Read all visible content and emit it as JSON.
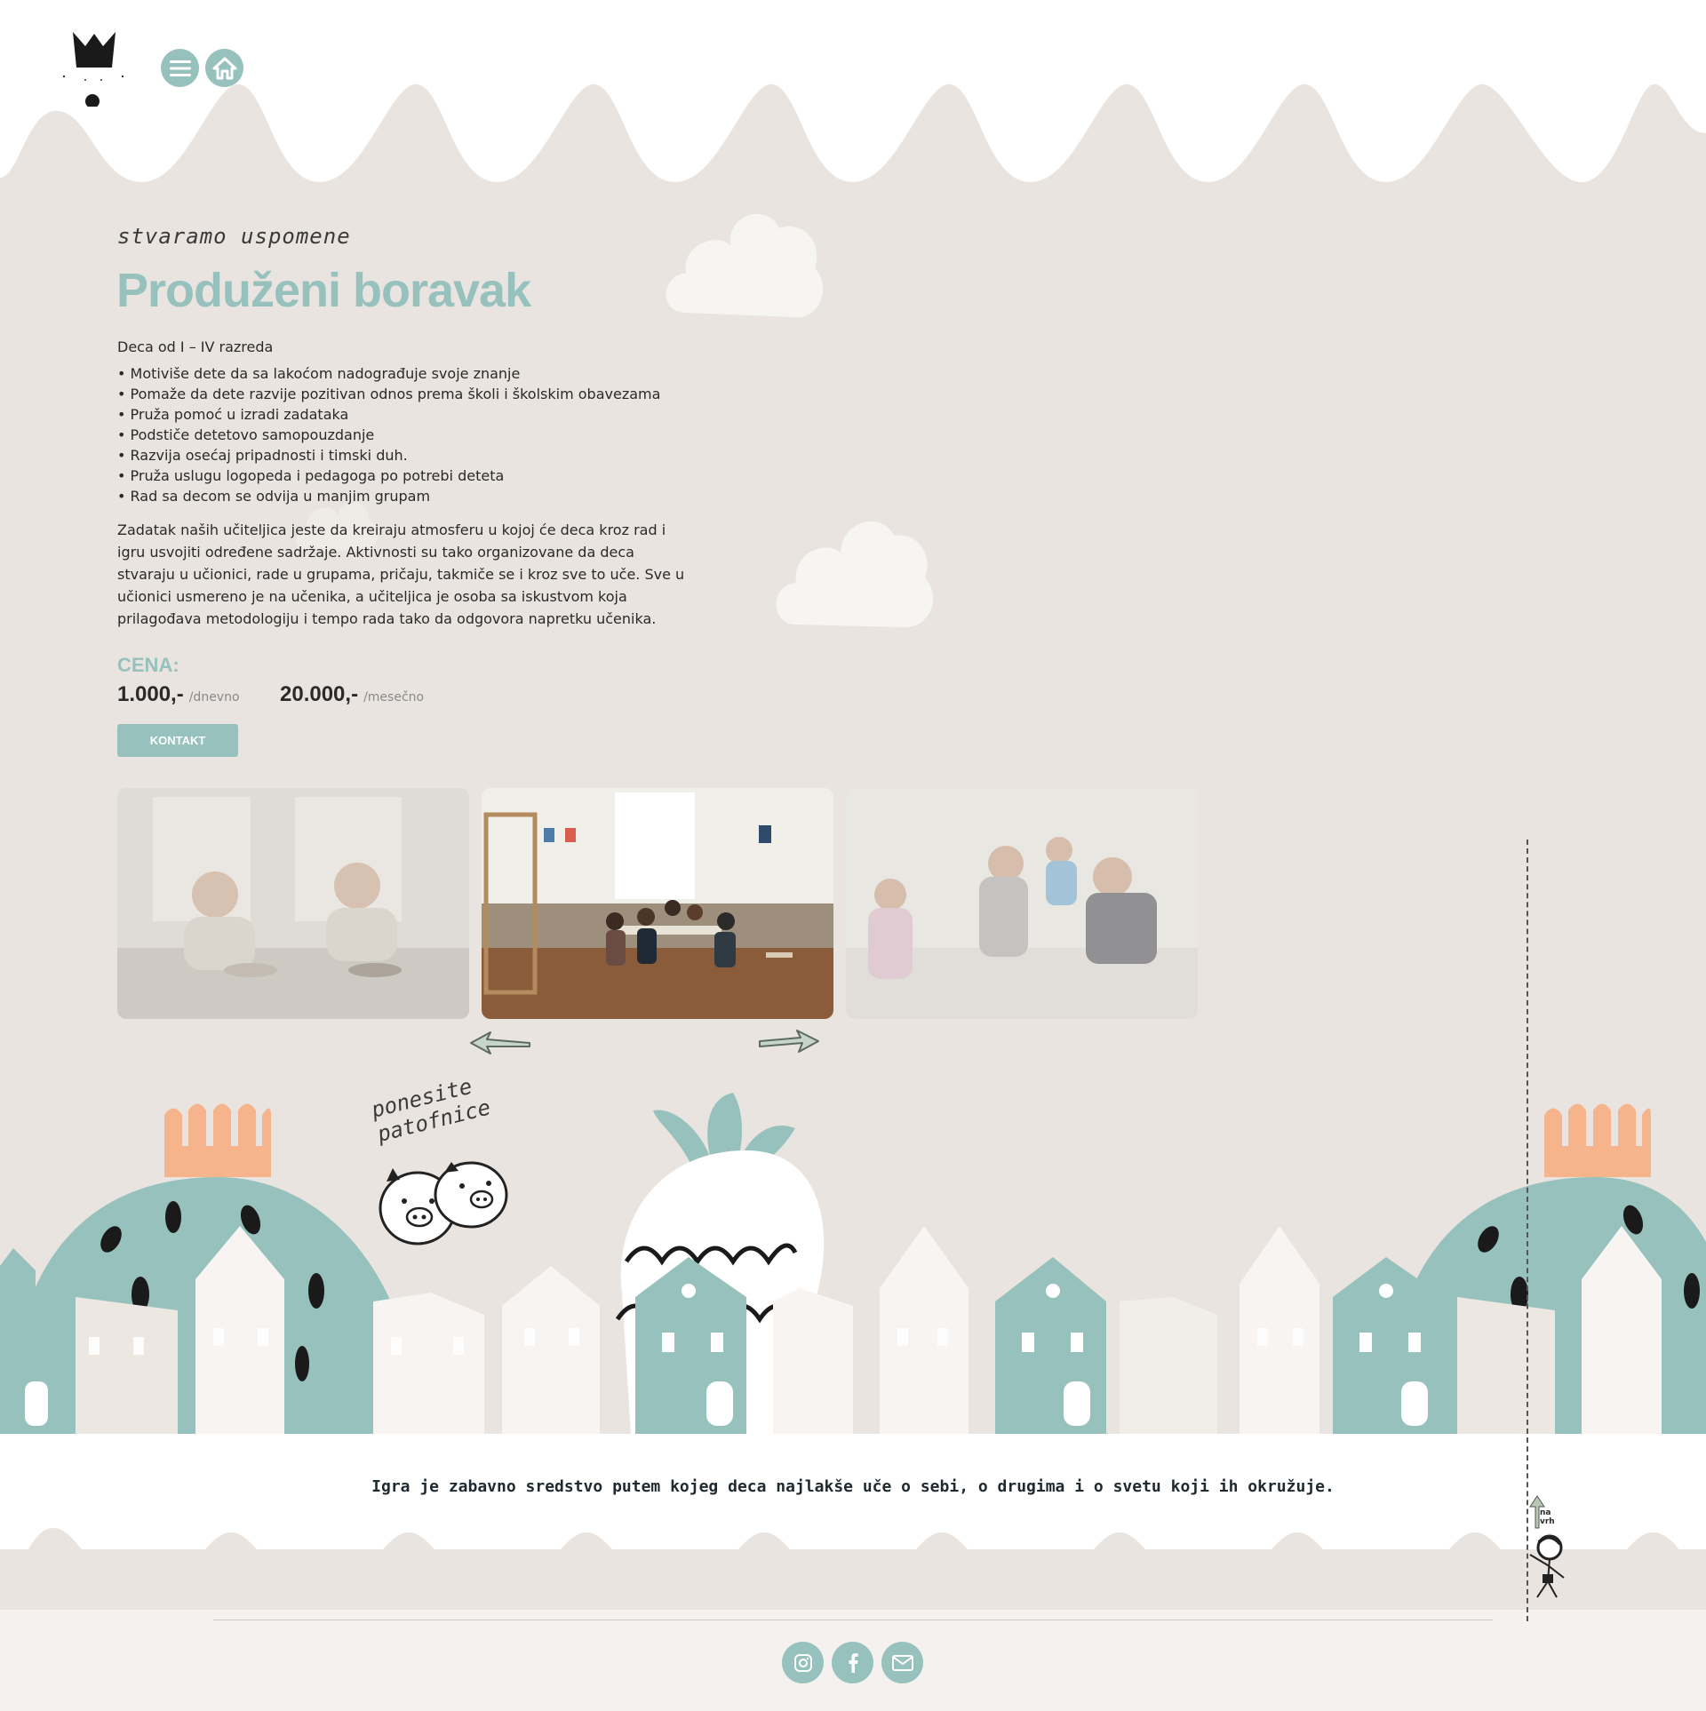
{
  "header": {
    "icons": [
      "crown-logo",
      "menu-icon",
      "home-icon"
    ]
  },
  "content": {
    "tagline": "stvaramo uspomene",
    "title": "Produženi boravak",
    "age_group": "Deca od I – IV razreda",
    "features": [
      "Motiviše dete da sa lakoćom nadograđuje svoje znanje",
      "Pomaže da dete razvije pozitivan odnos prema školi i školskim obavezama",
      "Pruža pomoć u izradi zadataka",
      "Podstiče detetovo samopouzdanje",
      "Razvija osećaj pripadnosti i timski duh.",
      "Pruža uslugu logopeda i pedagoga po potrebi deteta",
      "Rad sa decom se odvija u manjim grupam"
    ],
    "description": "Zadatak naših učiteljica jeste da kreiraju atmosferu u kojoj će deca kroz rad i igru usvojiti određene sadržaje. Aktivnosti su tako organizovane da deca stvaraju u učionici, rade u grupama, pričaju, takmiče se i kroz sve to uče. Sve u učionici usmereno je na učenika, a učiteljica je osoba sa iskustvom koja prilagođava metodologiju i tempo rada tako da odgovora napretku učenika.",
    "price_label": "CENA:",
    "price_daily": "1.000,-",
    "price_daily_unit": "/dnevno",
    "price_monthly": "20.000,-",
    "price_monthly_unit": "/mesečno",
    "contact_button": "KONTAKT"
  },
  "gallery": {
    "icons": [
      "arrow-left-icon",
      "arrow-right-icon"
    ]
  },
  "decor": {
    "slippers_line1": "ponesite",
    "slippers_line2": "patofnice"
  },
  "quote": "Igra je zabavno sredstvo putem kojeg deca najlakše uče o sebi, o drugima i o svetu koji ih okružuje.",
  "back_to_top": {
    "label": "na vrh"
  },
  "footer": {
    "icons": [
      "instagram-icon",
      "facebook-icon",
      "mail-icon"
    ]
  },
  "colors": {
    "background": "#e9e4df",
    "accent": "#97c1bd",
    "peach": "#f5b48b",
    "white": "#ffffff"
  }
}
